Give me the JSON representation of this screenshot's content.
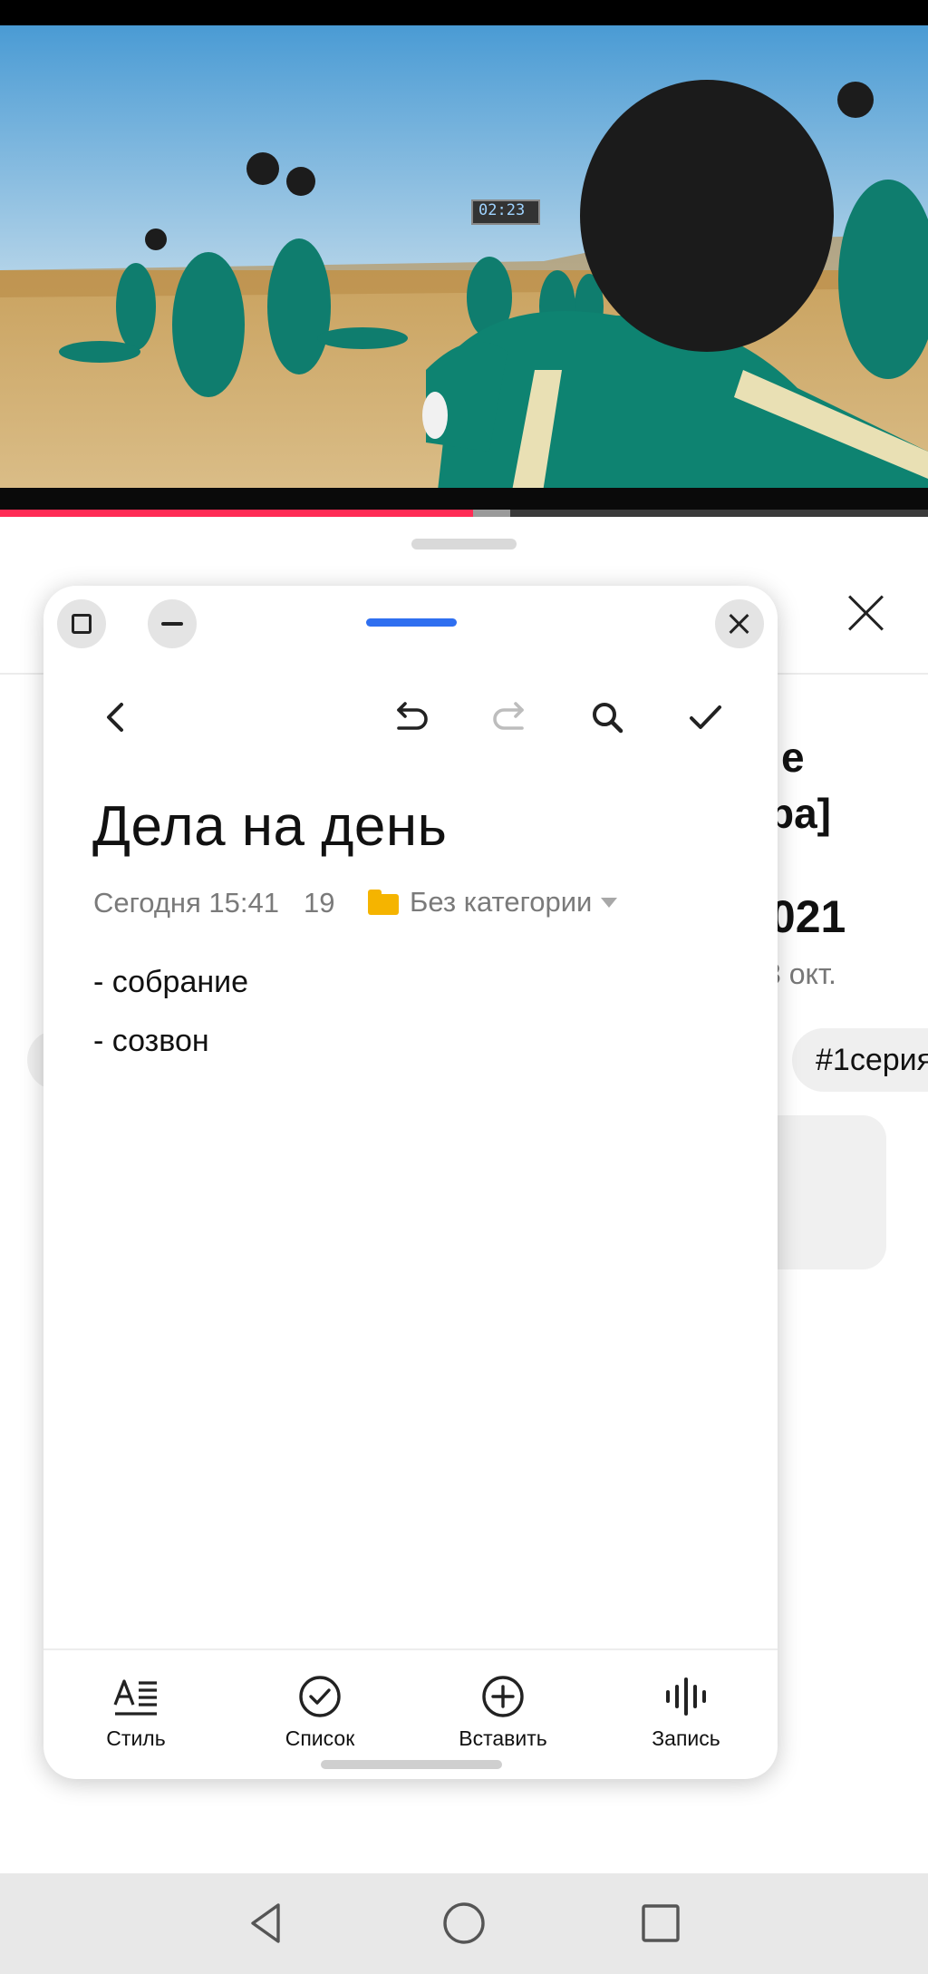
{
  "video": {
    "timer_text": "02:23",
    "progress": 0.51,
    "buffered": 0.55,
    "progress_color": "#ff2c55"
  },
  "background_sheet": {
    "title_line1": "е",
    "title_line2": "ра]",
    "year_text": ".021",
    "date_text": "3 окт.",
    "tag_text": "#1серия"
  },
  "note": {
    "title": "Дела на день",
    "meta_date": "Сегодня 15:41",
    "char_count": "19",
    "category": "Без категории",
    "lines": [
      "- собрание",
      "- созвон"
    ]
  },
  "toolbar": {
    "icons": [
      "back-icon",
      "undo-icon",
      "redo-icon",
      "search-icon",
      "check-icon"
    ]
  },
  "bottom_bar": {
    "style_label": "Стиль",
    "list_label": "Список",
    "insert_label": "Вставить",
    "record_label": "Запись"
  },
  "colors": {
    "accent_blue": "#2f6ff0",
    "folder_yellow": "#f5b400",
    "video_progress": "#ff2c55"
  }
}
